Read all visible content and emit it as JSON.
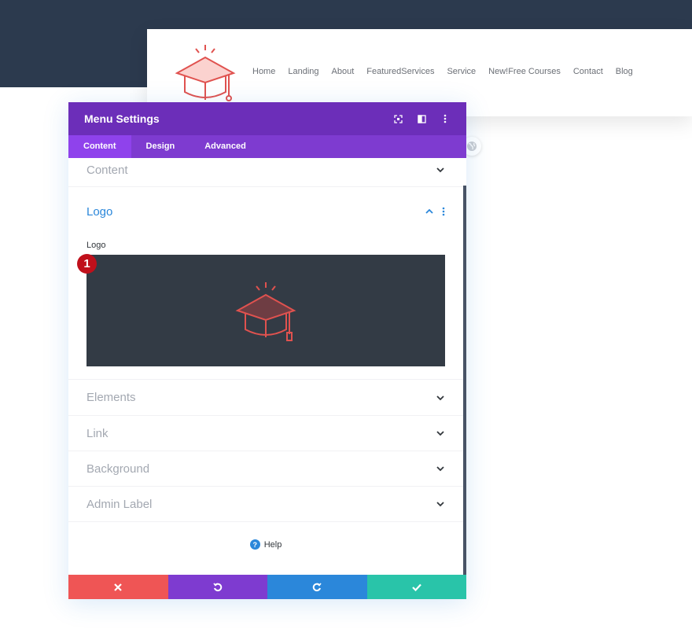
{
  "site": {
    "nav": [
      "Home",
      "Landing",
      "About",
      "FeaturedServices",
      "Service",
      "New!Free Courses",
      "Contact",
      "Blog"
    ]
  },
  "modal": {
    "title": "Menu Settings",
    "tabs": [
      "Content",
      "Design",
      "Advanced"
    ],
    "sections": {
      "content": "Content",
      "logo": "Logo",
      "elements": "Elements",
      "link": "Link",
      "background": "Background",
      "admin_label": "Admin Label"
    },
    "logo_field_label": "Logo",
    "badge": "1",
    "help": "Help"
  },
  "colors": {
    "header": "#6c2eb9",
    "tabs": "#7e3bd0",
    "accent_blue": "#2b87da",
    "cancel": "#ef5555",
    "save": "#29c4a9",
    "logo_red": "#e0524f"
  }
}
